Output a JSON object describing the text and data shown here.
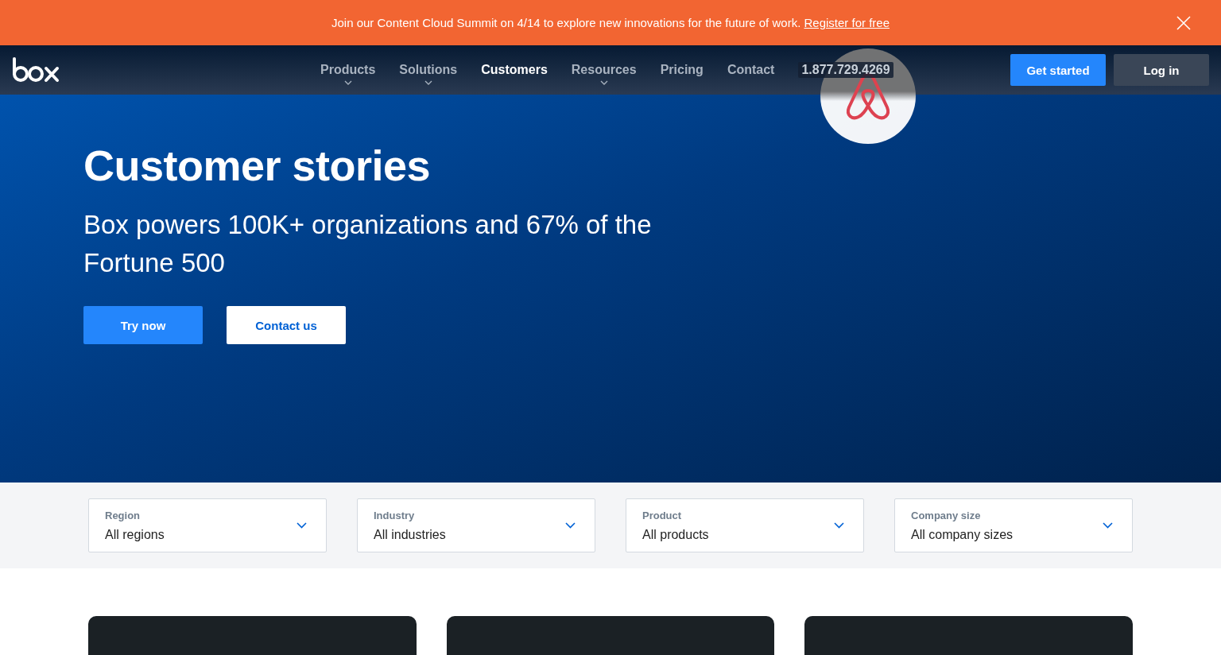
{
  "banner": {
    "message": "Join our Content Cloud Summit on 4/14 to explore new innovations for the future of work.",
    "link": "Register for free"
  },
  "nav": {
    "items": [
      {
        "label": "Products",
        "has_menu": true,
        "selected": false
      },
      {
        "label": "Solutions",
        "has_menu": true,
        "selected": false
      },
      {
        "label": "Customers",
        "has_menu": false,
        "selected": true
      },
      {
        "label": "Resources",
        "has_menu": true,
        "selected": false
      },
      {
        "label": "Pricing",
        "has_menu": false,
        "selected": false
      },
      {
        "label": "Contact",
        "has_menu": false,
        "selected": false
      }
    ],
    "phone": "1.877.729.4269",
    "primary_button": "Get started",
    "secondary_button": "Log in"
  },
  "hero": {
    "title": "Customer stories",
    "subtitle": "Box powers 100K+ organizations and 67% of the Fortune 500",
    "buttons": [
      {
        "label": "Try now",
        "kind": "primary"
      },
      {
        "label": "Contact us",
        "kind": "secondary"
      }
    ]
  },
  "filters": [
    {
      "label": "Region",
      "value": "All regions"
    },
    {
      "label": "Industry",
      "value": "All industries"
    },
    {
      "label": "Product",
      "value": "All products"
    },
    {
      "label": "Company size",
      "value": "All company sizes"
    }
  ],
  "cards": [
    {
      "kind": "story"
    },
    {
      "kind": "story"
    },
    {
      "kind": "story"
    }
  ]
}
